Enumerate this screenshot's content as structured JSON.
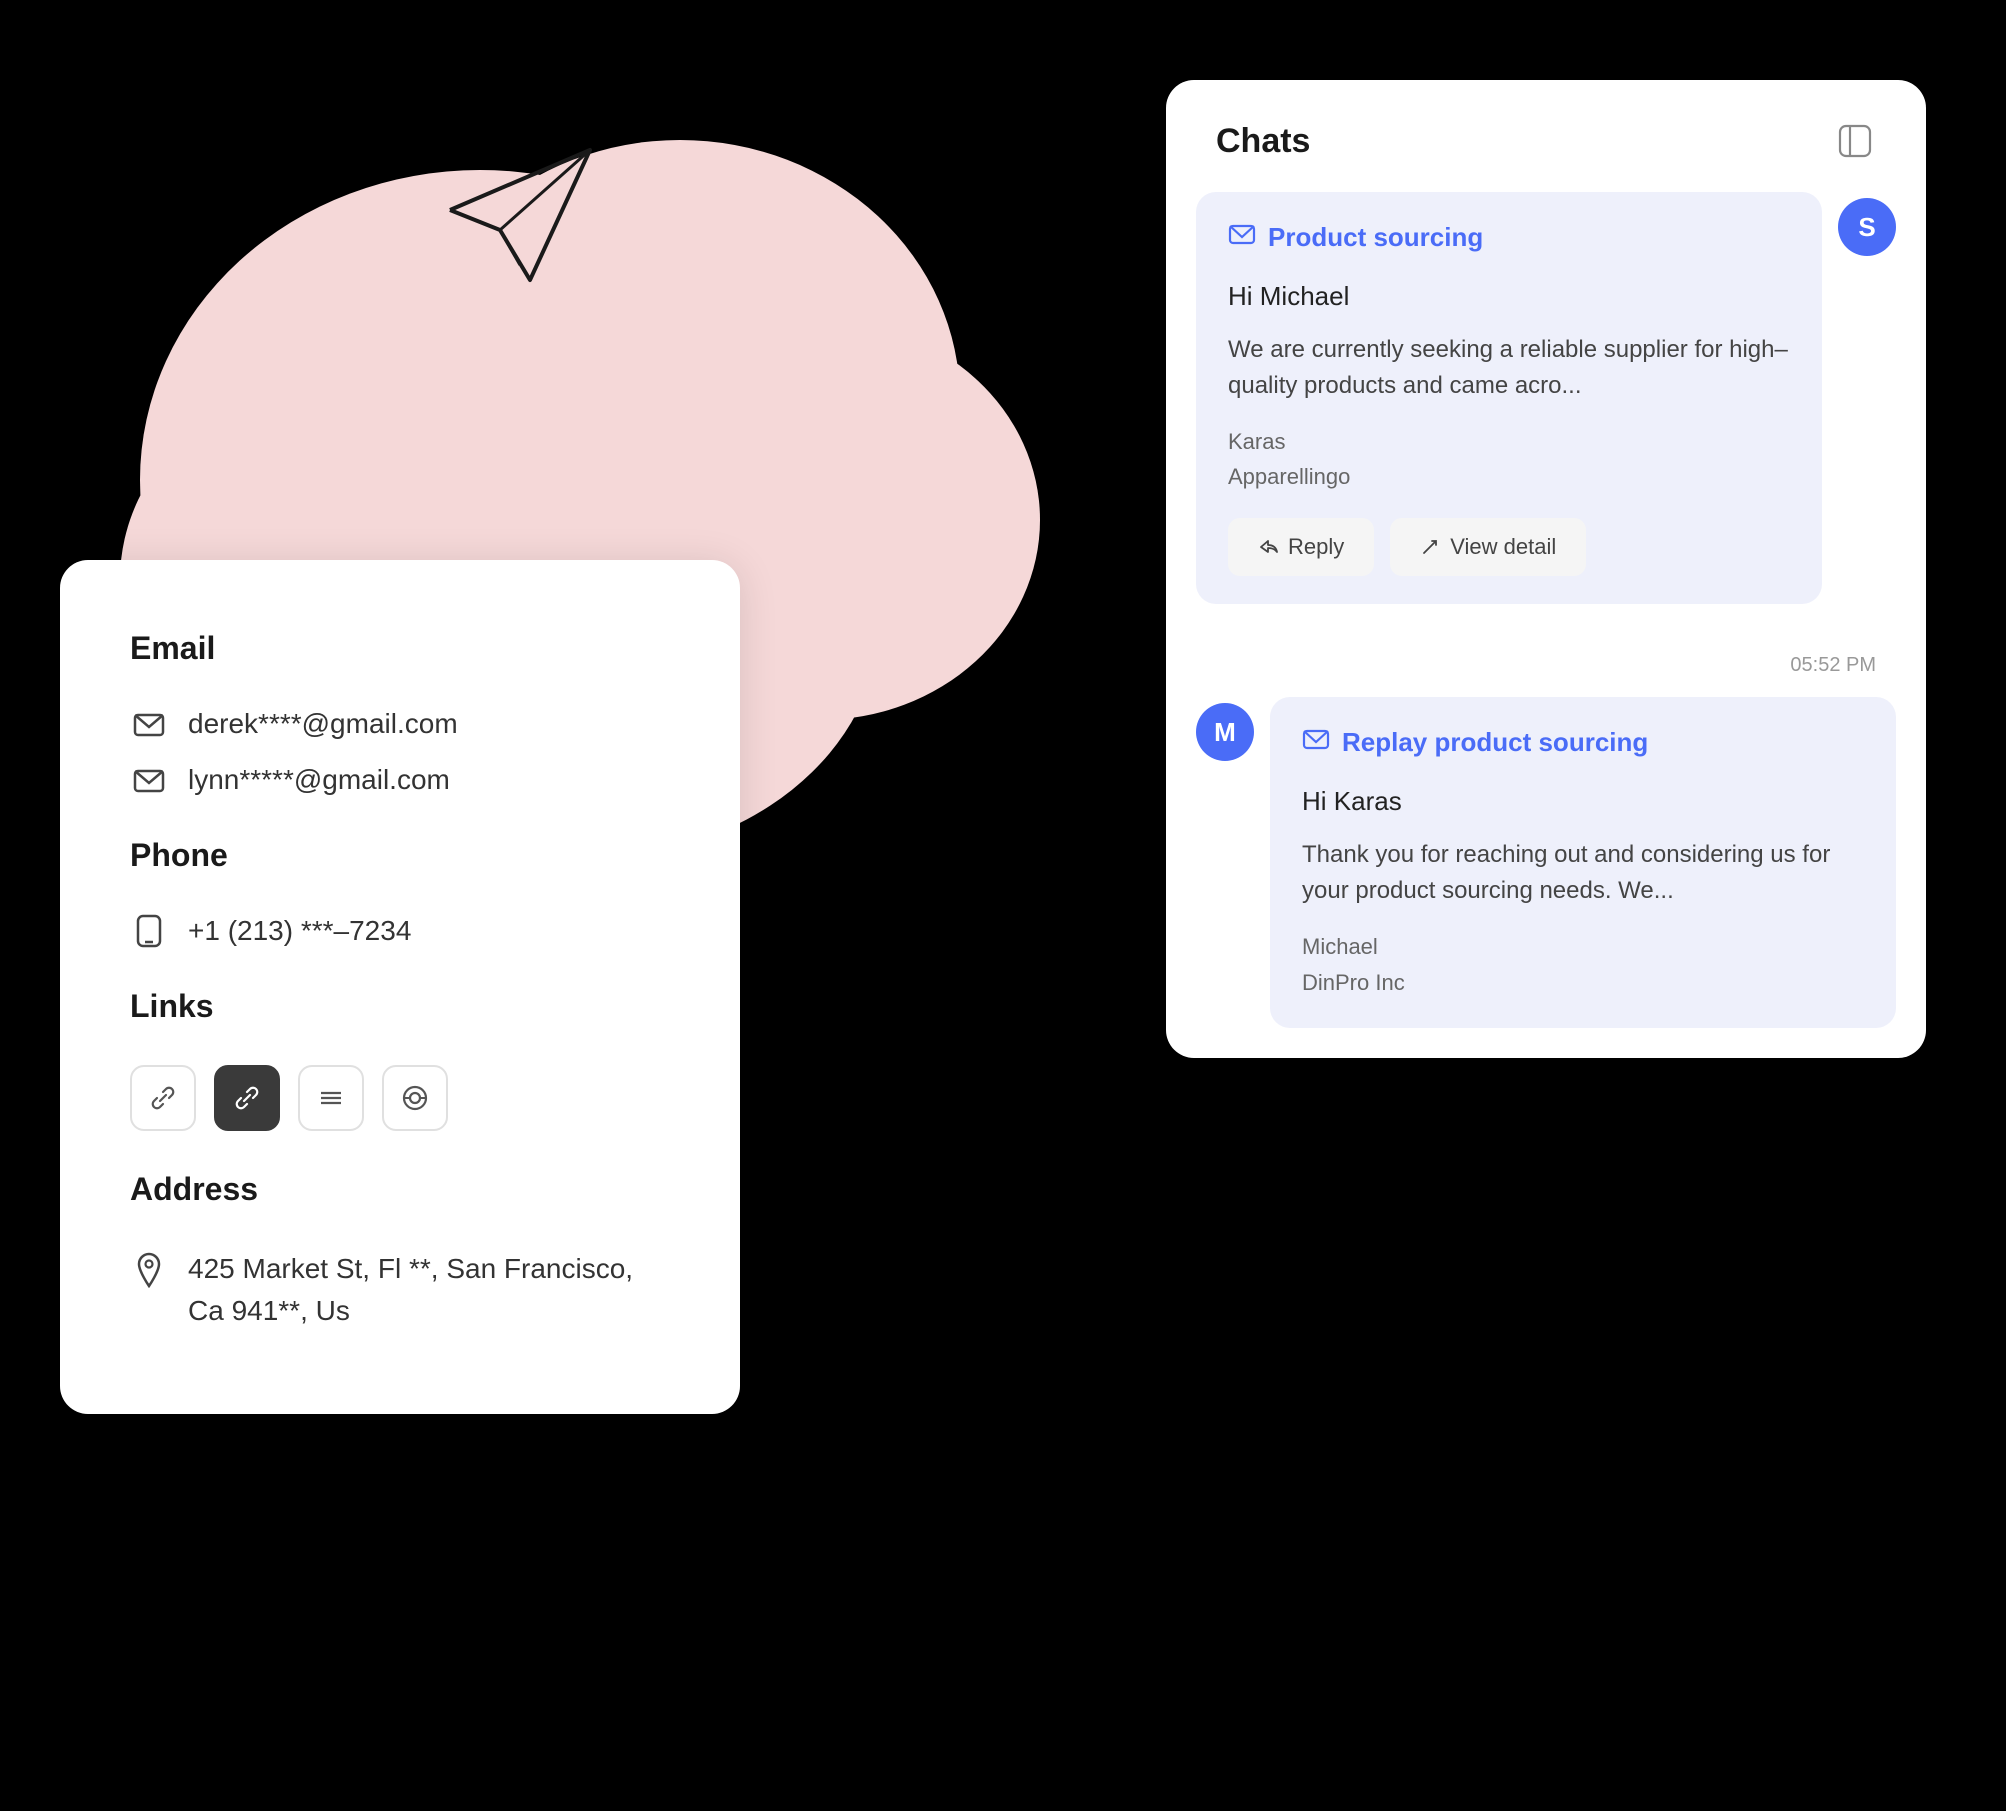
{
  "background": "#000000",
  "cloud": {
    "color": "#f5d8d8"
  },
  "chat": {
    "panel_title": "Chats",
    "sidebar_icon": "⊞",
    "message1": {
      "avatar_letter": "S",
      "subject": "Product sourcing",
      "greeting": "Hi Michael",
      "body": "We are currently seeking a reliable supplier for high–quality products and came acro...",
      "sender_name": "Karas",
      "sender_company": "Apparellingo",
      "reply_label": "Reply",
      "view_detail_label": "View detail",
      "timestamp": "05:52 PM"
    },
    "message2": {
      "avatar_letter": "M",
      "subject": "Replay product sourcing",
      "greeting": "Hi Karas",
      "body": "Thank you for reaching out and considering us for your product sourcing needs. We...",
      "sender_name": "Michael",
      "sender_company": "DinPro Inc"
    }
  },
  "contact": {
    "email_section_title": "Email",
    "emails": [
      "derek****@gmail.com",
      "lynn*****@gmail.com"
    ],
    "phone_section_title": "Phone",
    "phone": "+1 (213) ***–7234",
    "links_section_title": "Links",
    "links": [
      "🔗",
      "🔗",
      "◈",
      "⊛"
    ],
    "address_section_title": "Address",
    "address": "425 Market St, Fl **, San Francisco, Ca 941**, Us"
  }
}
